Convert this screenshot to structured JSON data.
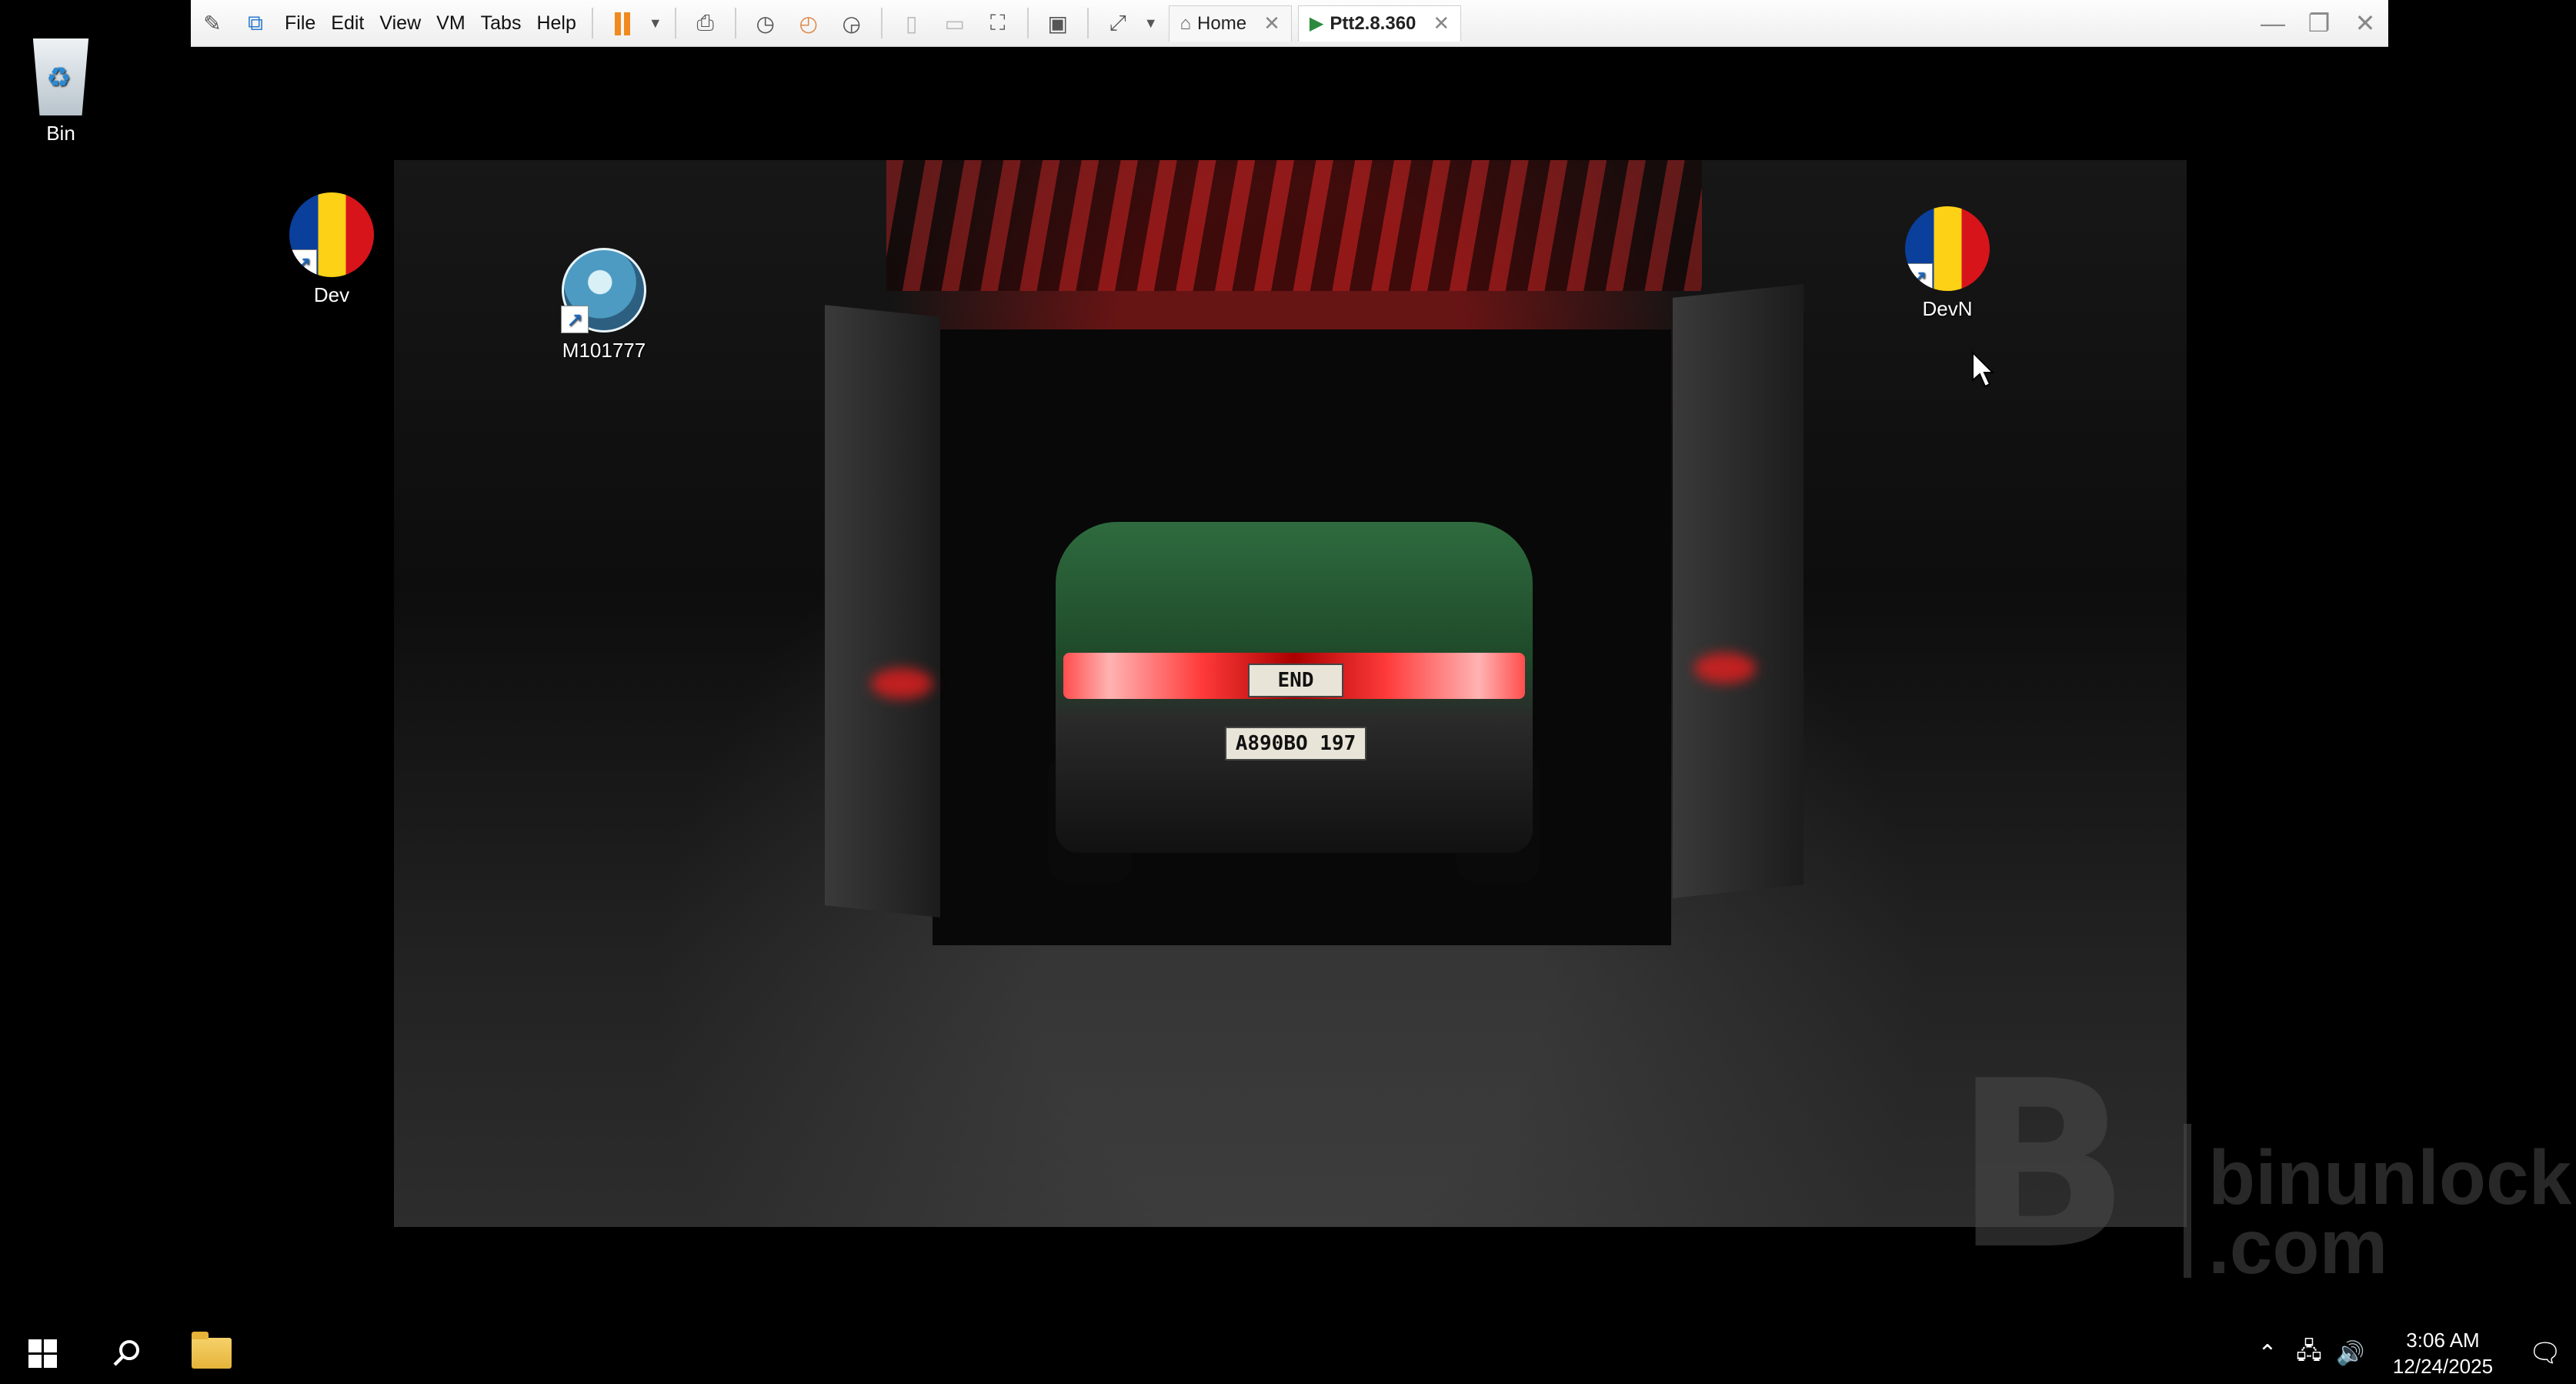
{
  "toolbar": {
    "menus": [
      "File",
      "Edit",
      "View",
      "VM",
      "Tabs",
      "Help"
    ],
    "tabs": [
      {
        "label": "Home",
        "icon": "home-icon",
        "active": false
      },
      {
        "label": "Ptt2.8.360",
        "icon": "vm-icon",
        "active": true
      }
    ],
    "accent_color": "#f08a1e"
  },
  "desktop": {
    "icons": [
      {
        "name": "recycle-bin",
        "label": "Bin"
      },
      {
        "name": "dev-shortcut",
        "label": "Dev"
      },
      {
        "name": "m101777-shortcut",
        "label": "M101777"
      },
      {
        "name": "devn-shortcut",
        "label": "DevN"
      }
    ],
    "wallpaper": {
      "plate_top": "END",
      "plate_bottom": "A890BO 197"
    },
    "watermark": {
      "line1": "binunlock",
      "line2": ".com"
    }
  },
  "taskbar": {
    "time": "3:06 AM",
    "date": "12/24/2025"
  }
}
